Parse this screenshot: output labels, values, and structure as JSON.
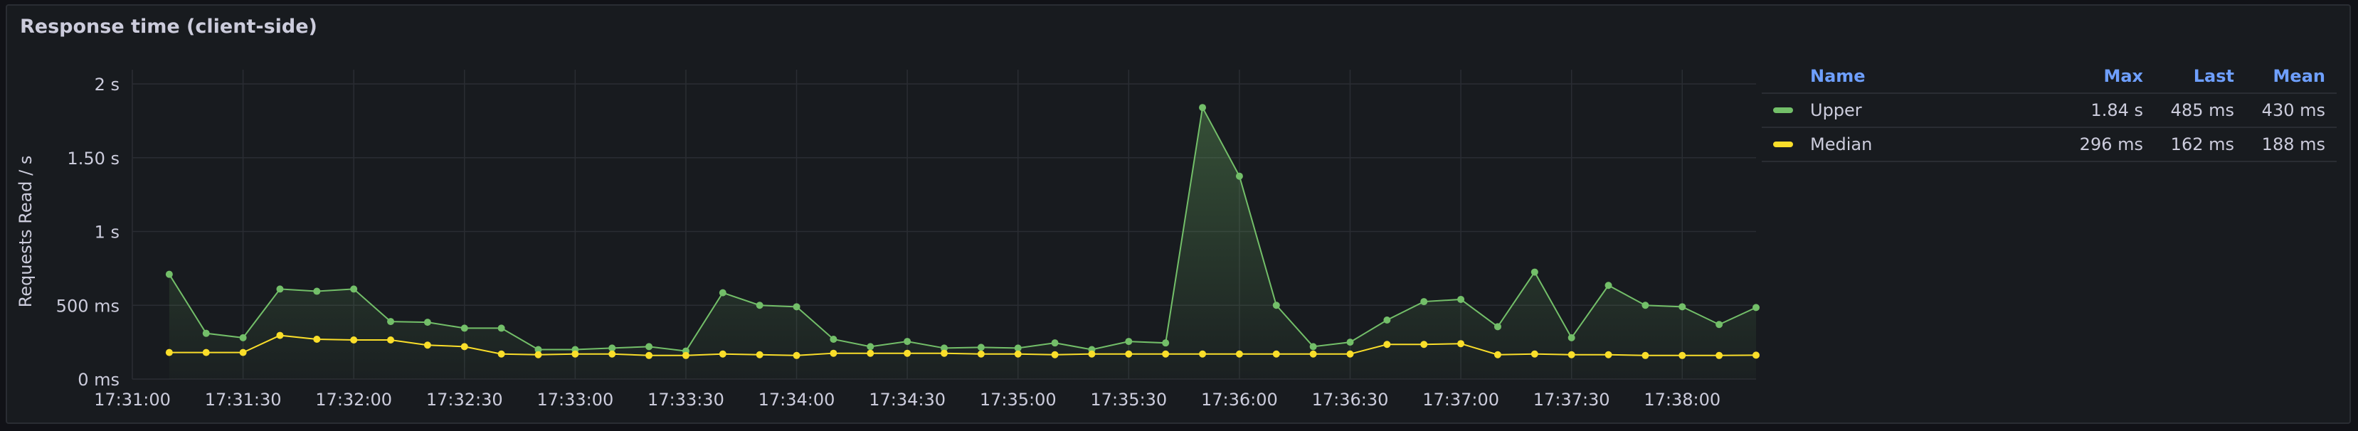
{
  "panel": {
    "title": "Response time (client-side)"
  },
  "colors": {
    "upper": "#73bf69",
    "median": "#fade2a",
    "grid": "#2a2d33",
    "axis_text": "#ccccdc",
    "legend_header": "#6e9fff"
  },
  "legend": {
    "headers": {
      "name": "Name",
      "max": "Max",
      "last": "Last",
      "mean": "Mean"
    },
    "rows": [
      {
        "name": "Upper",
        "max": "1.84 s",
        "last": "485 ms",
        "mean": "430 ms",
        "color": "#73bf69"
      },
      {
        "name": "Median",
        "max": "296 ms",
        "last": "162 ms",
        "mean": "188 ms",
        "color": "#fade2a"
      }
    ]
  },
  "chart_data": {
    "type": "line",
    "ylabel": "Requests Read / s",
    "ylim_ms": [
      0,
      2000
    ],
    "y_ticks": [
      {
        "value": 0,
        "label": "0 ms"
      },
      {
        "value": 500,
        "label": "500 ms"
      },
      {
        "value": 1000,
        "label": "1 s"
      },
      {
        "value": 1500,
        "label": "1.50 s"
      },
      {
        "value": 2000,
        "label": "2 s"
      }
    ],
    "x_ticks": [
      "17:31:00",
      "17:31:30",
      "17:32:00",
      "17:32:30",
      "17:33:00",
      "17:33:30",
      "17:34:00",
      "17:34:30",
      "17:35:00",
      "17:35:30",
      "17:36:00",
      "17:36:30",
      "17:37:00",
      "17:37:30",
      "17:38:00"
    ],
    "xlim": [
      "17:31:00",
      "17:38:20"
    ],
    "x": [
      "17:31:10",
      "17:31:20",
      "17:31:30",
      "17:31:40",
      "17:31:50",
      "17:32:00",
      "17:32:10",
      "17:32:20",
      "17:32:30",
      "17:32:40",
      "17:32:50",
      "17:33:00",
      "17:33:10",
      "17:33:20",
      "17:33:30",
      "17:33:40",
      "17:33:50",
      "17:34:00",
      "17:34:10",
      "17:34:20",
      "17:34:30",
      "17:34:40",
      "17:34:50",
      "17:35:00",
      "17:35:10",
      "17:35:20",
      "17:35:30",
      "17:35:40",
      "17:35:50",
      "17:36:00",
      "17:36:10",
      "17:36:20",
      "17:36:30",
      "17:36:40",
      "17:36:50",
      "17:37:00",
      "17:37:10",
      "17:37:20",
      "17:37:30",
      "17:37:40",
      "17:37:50",
      "17:38:00",
      "17:38:10",
      "17:38:20"
    ],
    "series": [
      {
        "name": "Upper",
        "color": "#73bf69",
        "fill": true,
        "values_ms": [
          710,
          310,
          280,
          610,
          595,
          610,
          390,
          385,
          345,
          345,
          200,
          200,
          210,
          220,
          190,
          585,
          500,
          490,
          270,
          220,
          255,
          210,
          215,
          210,
          245,
          200,
          255,
          245,
          1840,
          1375,
          500,
          220,
          250,
          400,
          525,
          540,
          355,
          725,
          280,
          635,
          500,
          490,
          370,
          485
        ]
      },
      {
        "name": "Median",
        "color": "#fade2a",
        "fill": false,
        "values_ms": [
          180,
          180,
          180,
          296,
          270,
          265,
          265,
          230,
          220,
          170,
          165,
          170,
          170,
          160,
          160,
          170,
          165,
          160,
          175,
          175,
          175,
          175,
          170,
          170,
          165,
          170,
          170,
          170,
          170,
          170,
          170,
          170,
          170,
          235,
          235,
          240,
          165,
          170,
          165,
          165,
          160,
          160,
          160,
          162
        ]
      }
    ]
  }
}
